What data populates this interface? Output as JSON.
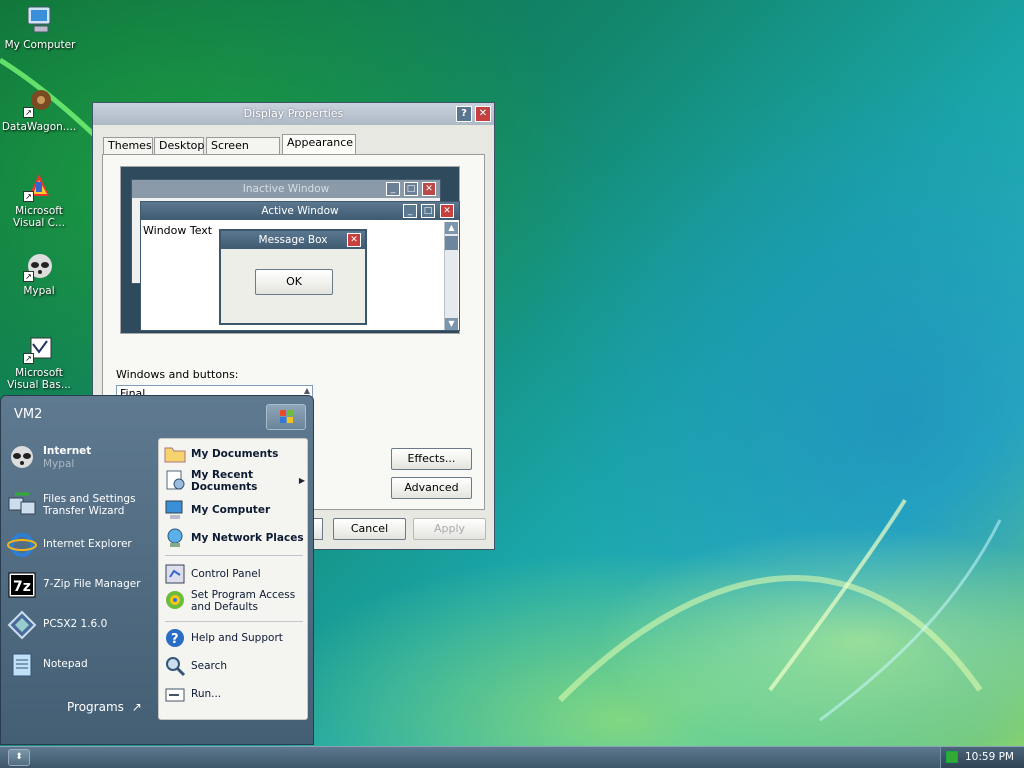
{
  "desktop": {
    "icons": [
      {
        "label": "My Computer"
      },
      {
        "label": "DataWagon...."
      },
      {
        "label": "Microsoft Visual C..."
      },
      {
        "label": "Mypal"
      },
      {
        "label": "Microsoft Visual Bas..."
      }
    ]
  },
  "window": {
    "title": "Display Properties",
    "help_btn": "?",
    "close_btn": "✕",
    "tabs": [
      "Themes",
      "Desktop",
      "Screen Saver",
      "Appearance"
    ],
    "active_tab": "Appearance",
    "preview": {
      "inactive_title": "Inactive Window",
      "active_title": "Active Window",
      "window_text": "Window Text",
      "message_title": "Message Box",
      "ok": "OK"
    },
    "windows_buttons_label": "Windows and buttons:",
    "windows_buttons_value": "Final",
    "effects_btn": "Effects...",
    "advanced_btn": "Advanced",
    "cancel_btn": "Cancel",
    "apply_btn": "Apply"
  },
  "start_menu": {
    "user": "VM2",
    "left": [
      {
        "label": "Internet",
        "sub": "Mypal"
      },
      {
        "label": "Files and Settings Transfer Wizard"
      },
      {
        "label": "Internet Explorer"
      },
      {
        "label": "7-Zip File Manager"
      },
      {
        "label": "PCSX2 1.6.0"
      },
      {
        "label": "Notepad"
      }
    ],
    "programs": "Programs",
    "right": [
      {
        "label": "My Documents"
      },
      {
        "label": "My Recent Documents"
      },
      {
        "label": "My Computer"
      },
      {
        "label": "My Network Places"
      },
      {
        "label": "Control Panel"
      },
      {
        "label": "Set Program Access and Defaults"
      },
      {
        "label": "Help and Support"
      },
      {
        "label": "Search"
      },
      {
        "label": "Run..."
      }
    ]
  },
  "taskbar": {
    "clock": "10:59 PM"
  },
  "colors": {
    "accent_close": "#c8403e",
    "title_active": "#4a6a88"
  }
}
